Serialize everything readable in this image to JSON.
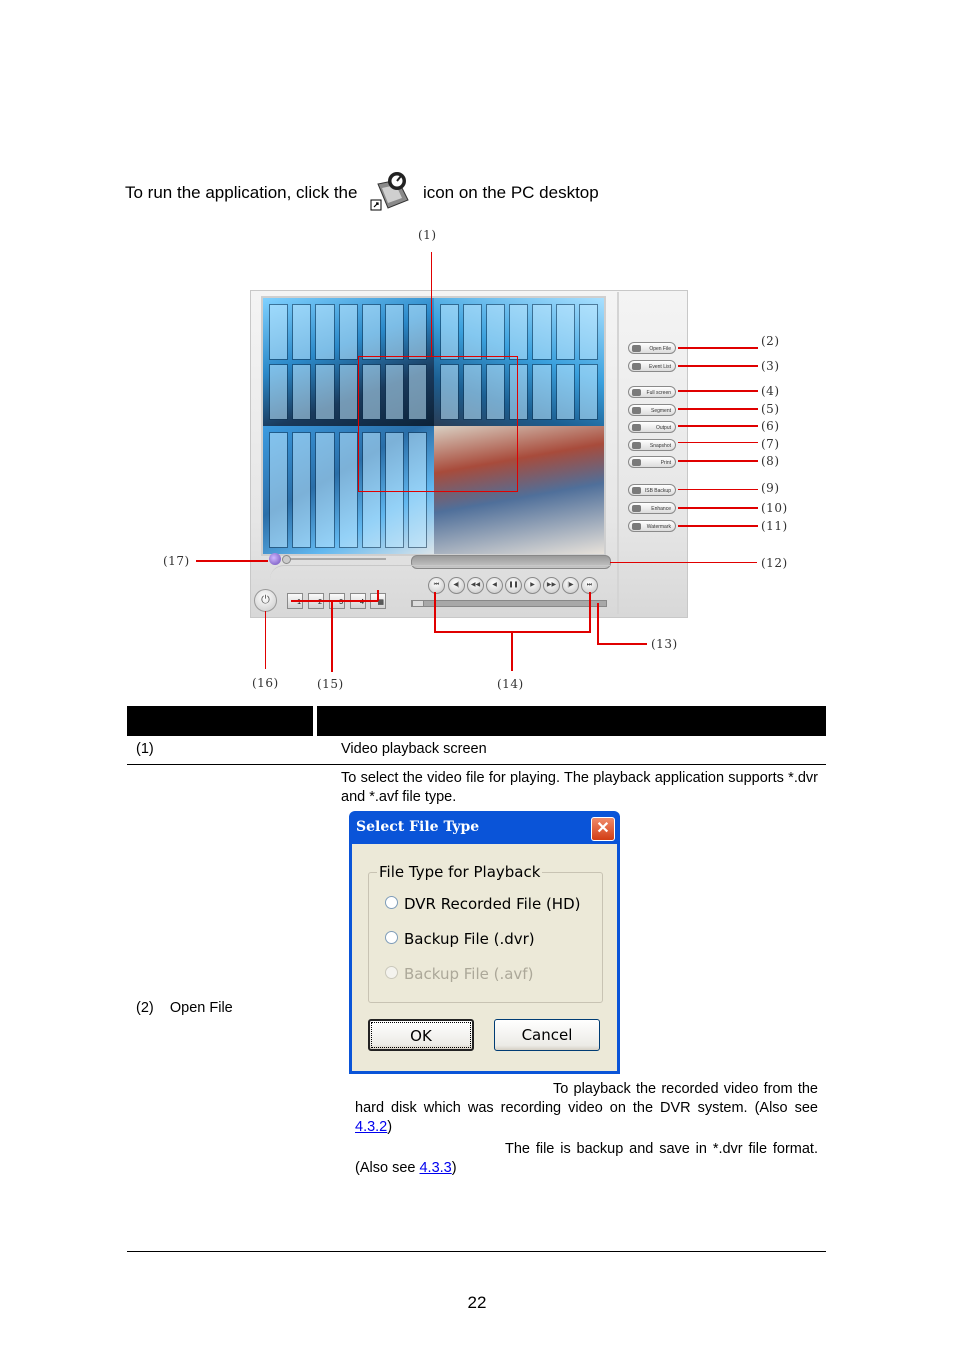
{
  "intro": {
    "before": "To run the application, click  the",
    "icon": "dvr-playback-desktop-icon",
    "after": "icon on the PC desktop"
  },
  "figure": {
    "callouts": [
      "(1)",
      "(2)",
      "(3)",
      "(4)",
      "(5)",
      "(6)",
      "(7)",
      "(8)",
      "(9)",
      "(10)",
      "(11)",
      "(12)",
      "(13)",
      "(14)",
      "(15)",
      "(16)",
      "(17)"
    ],
    "side_buttons": [
      {
        "label": "Open File",
        "icon": "folder-icon"
      },
      {
        "label": "Event List",
        "icon": "event-list-icon"
      },
      {
        "label": "Full screen",
        "icon": "fullscreen-icon"
      },
      {
        "label": "Segment",
        "icon": "segment-icon"
      },
      {
        "label": "Output",
        "icon": "output-icon"
      },
      {
        "label": "Snapshot",
        "icon": "snapshot-icon"
      },
      {
        "label": "Print",
        "icon": "printer-icon"
      },
      {
        "label": "ISB Backup",
        "icon": "backup-icon"
      },
      {
        "label": "Enhance",
        "icon": "enhance-icon"
      },
      {
        "label": "Watermark",
        "icon": "watermark-icon"
      }
    ],
    "camera_buttons": [
      "1",
      "2",
      "3",
      "4",
      "all"
    ],
    "playback_buttons": [
      {
        "glyph": "⏮",
        "name": "begin-icon"
      },
      {
        "glyph": "◀|",
        "name": "step-back-icon"
      },
      {
        "glyph": "◀◀",
        "name": "rewind-icon"
      },
      {
        "glyph": "◀",
        "name": "reverse-play-icon"
      },
      {
        "glyph": "❚❚",
        "name": "pause-icon"
      },
      {
        "glyph": "▶",
        "name": "play-icon"
      },
      {
        "glyph": "▶▶",
        "name": "fast-forward-icon"
      },
      {
        "glyph": "|▶",
        "name": "step-forward-icon"
      },
      {
        "glyph": "⏭",
        "name": "end-icon"
      }
    ],
    "power_glyph": "⏻"
  },
  "table": {
    "rows": [
      {
        "item": "(1)",
        "description": "Video playback screen"
      },
      {
        "item_num": "(2)",
        "item_label": "Open File",
        "description": "To select the video file for playing. The playback application supports *.dvr and *.avf file type.",
        "dialog": {
          "title": "Select File Type",
          "close_glyph": "✕",
          "group_title": "File Type for Playback",
          "options": [
            {
              "label": "DVR Recorded File (HD)",
              "enabled": true
            },
            {
              "label": "Backup File (.dvr)",
              "enabled": true
            },
            {
              "label": "Backup File (.avf)",
              "enabled": false
            }
          ],
          "ok_label": "OK",
          "cancel_label": "Cancel"
        },
        "notes": [
          {
            "text": "To playback the recorded video from the hard disk which was recording video on the DVR system. (Also see ",
            "link": "4.3.2",
            "tail": ")"
          },
          {
            "text": "The file is backup and save in *.dvr file format. (Also see ",
            "link": "4.3.3",
            "tail": ")"
          }
        ]
      }
    ]
  },
  "footer": {
    "page_number": "22"
  }
}
